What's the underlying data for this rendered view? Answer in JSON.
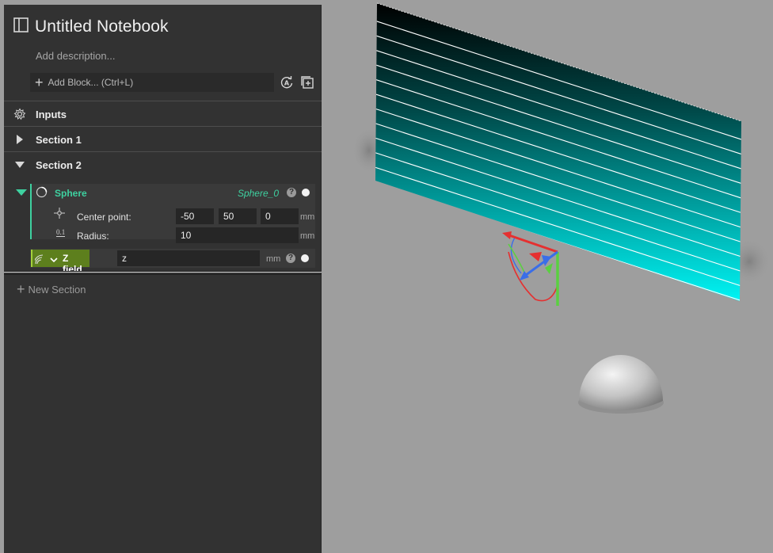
{
  "notebook": {
    "title": "Untitled Notebook",
    "description_placeholder": "Add description...",
    "add_block_label": "Add Block... (Ctrl+L)",
    "new_section_label": "New Section"
  },
  "inputs": {
    "label": "Inputs"
  },
  "sections": [
    {
      "label": "Section 1",
      "expanded": false
    },
    {
      "label": "Section 2",
      "expanded": true
    }
  ],
  "sphere": {
    "name": "Sphere",
    "variable": "Sphere_0",
    "help": "?",
    "center_point": {
      "label": "Center point:",
      "x": "-50",
      "y": "50",
      "z": "0",
      "unit": "mm"
    },
    "radius": {
      "label": "Radius:",
      "value": "10",
      "unit": "mm",
      "icon_text": "0.1"
    }
  },
  "zfield": {
    "name": "Z field",
    "value": "z",
    "unit": "mm",
    "help": "?"
  },
  "colors": {
    "accent_teal": "#3ed1a0",
    "zfield_green": "#5d7f1d",
    "plane_cyan": "#00ffff",
    "viewport_bg": "#9e9e9e"
  }
}
